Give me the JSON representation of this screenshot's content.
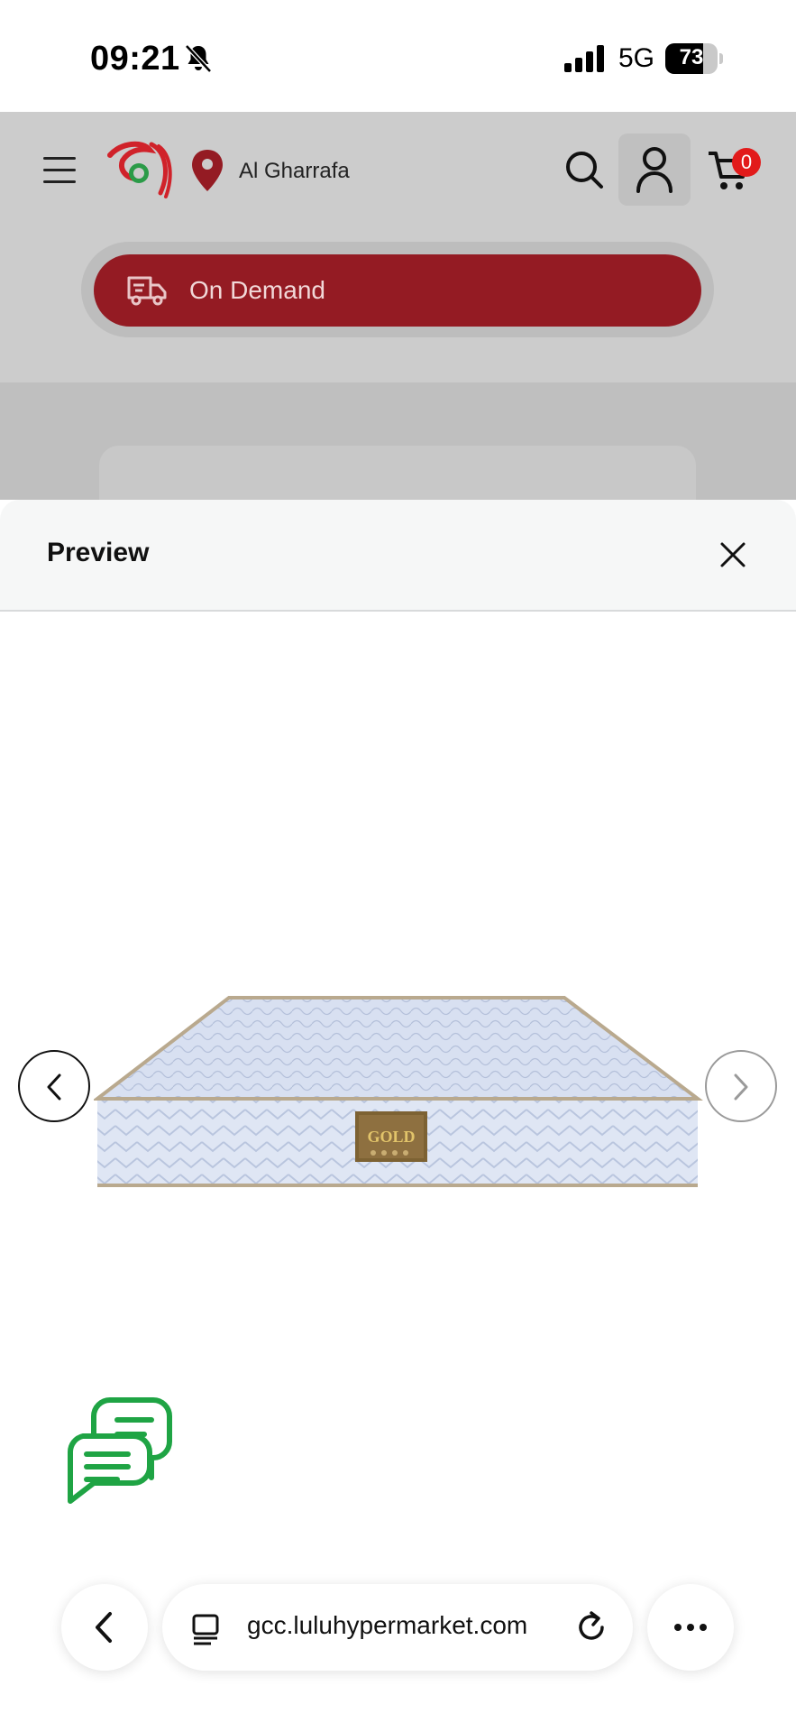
{
  "status_bar": {
    "time": "09:21",
    "network": "5G",
    "battery": "73",
    "battery_level": 0.73,
    "icons": [
      "bell-slash-icon",
      "signal-icon",
      "battery-icon"
    ]
  },
  "header": {
    "location": "Al Gharrafa",
    "cart_count": "0",
    "on_demand_label": "On Demand",
    "brand_color": "#941b23",
    "badge_color": "#e21b1b",
    "icons": [
      "menu-icon",
      "lulu-logo",
      "location-pin-icon",
      "search-icon",
      "user-icon",
      "cart-icon",
      "delivery-truck-icon"
    ]
  },
  "preview": {
    "title": "Preview",
    "image_alt": "mattress",
    "label_text": "GOLD",
    "icons": [
      "close-icon",
      "chevron-left-icon",
      "chevron-right-icon"
    ]
  },
  "chat": {
    "icon": "chat-bubbles-icon",
    "color": "#1fa444"
  },
  "browser": {
    "url": "gcc.luluhypermarket.com",
    "icons": [
      "back-icon",
      "tabs-icon",
      "reload-icon",
      "more-icon"
    ]
  }
}
